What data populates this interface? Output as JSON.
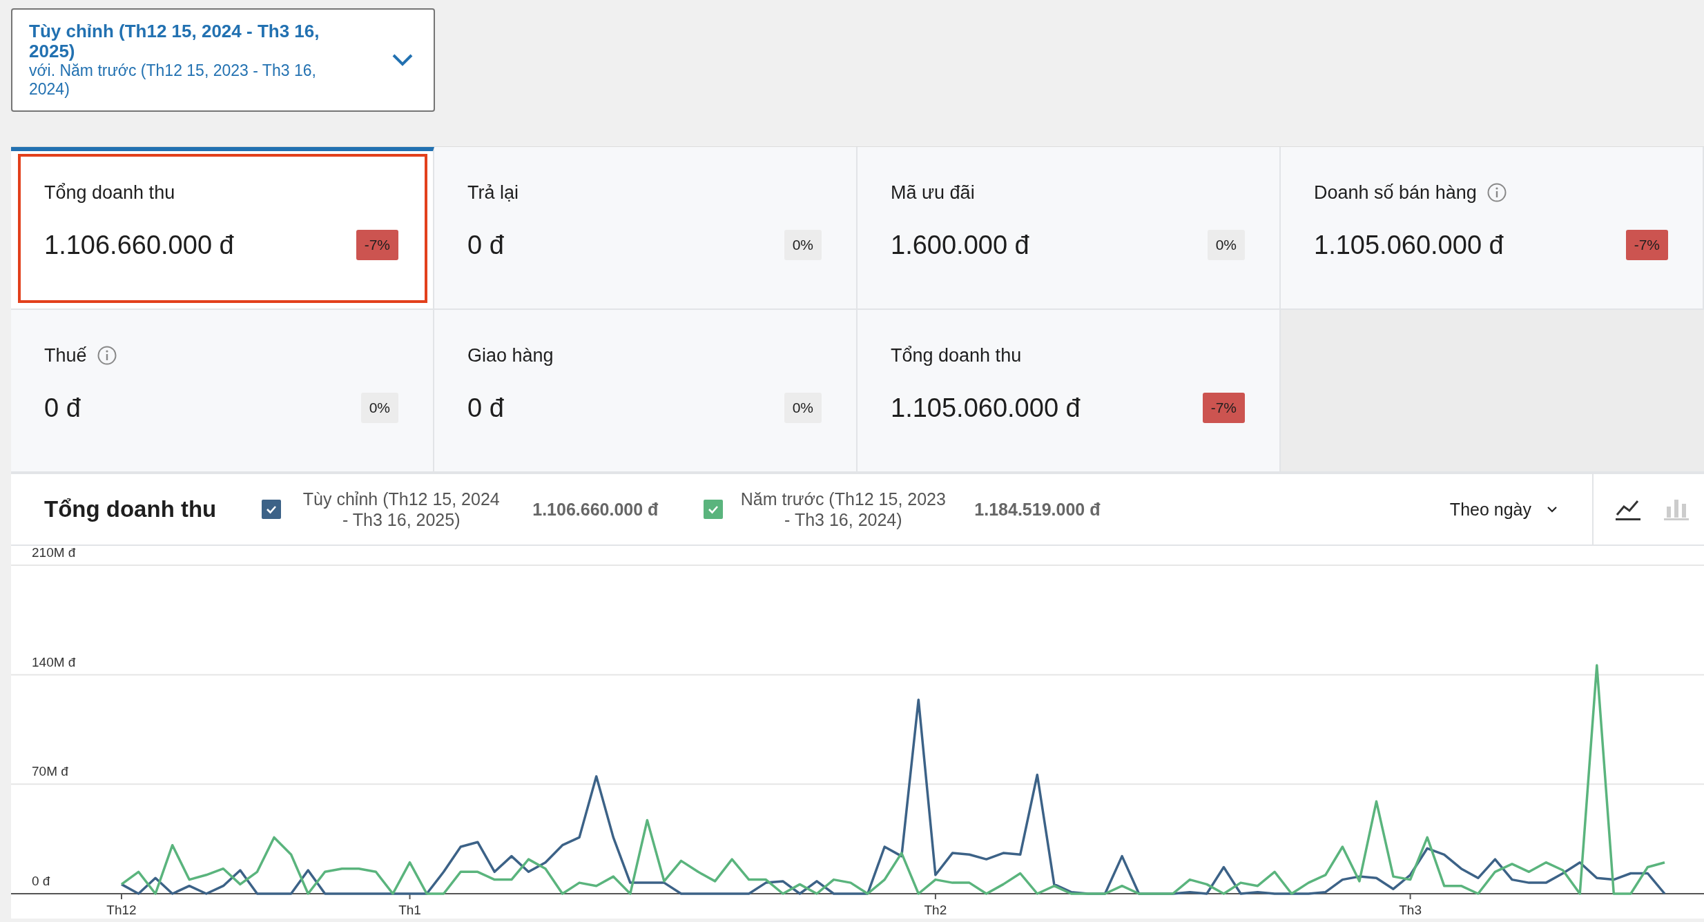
{
  "date_picker": {
    "title": "Tùy chỉnh (Th12 15, 2024 - Th3 16, 2025)",
    "compare": "với. Năm trước (Th12 15, 2023 - Th3 16, 2024)"
  },
  "cards": [
    {
      "label": "Tổng doanh thu",
      "value": "1.106.660.000 đ",
      "delta": "-7%",
      "kind": "negative",
      "info": false,
      "selected": true
    },
    {
      "label": "Trả lại",
      "value": "0 đ",
      "delta": "0%",
      "kind": "neutral",
      "info": false,
      "selected": false
    },
    {
      "label": "Mã ưu đãi",
      "value": "1.600.000 đ",
      "delta": "0%",
      "kind": "neutral",
      "info": false,
      "selected": false
    },
    {
      "label": "Doanh số bán hàng",
      "value": "1.105.060.000 đ",
      "delta": "-7%",
      "kind": "negative",
      "info": true,
      "selected": false
    },
    {
      "label": "Thuế",
      "value": "0 đ",
      "delta": "0%",
      "kind": "neutral",
      "info": true,
      "selected": false
    },
    {
      "label": "Giao hàng",
      "value": "0 đ",
      "delta": "0%",
      "kind": "neutral",
      "info": false,
      "selected": false
    },
    {
      "label": "Tổng doanh thu",
      "value": "1.105.060.000 đ",
      "delta": "-7%",
      "kind": "negative",
      "info": false,
      "selected": false
    }
  ],
  "chart_panel": {
    "title": "Tổng doanh thu",
    "legend": [
      {
        "total": "1.106.660.000 đ",
        "checked": true
      },
      {
        "total": "1.184.519.000 đ",
        "checked": true
      }
    ],
    "interval": "Theo ngày",
    "chart_types": [
      {
        "kind": "line",
        "selected": true
      },
      {
        "kind": "bar",
        "selected": false
      }
    ],
    "chart_data": {
      "type": "line",
      "categories": [
        "Th12",
        null,
        null,
        null,
        null,
        null,
        null,
        null,
        null,
        null,
        null,
        null,
        null,
        null,
        null,
        null,
        null,
        "Th1",
        null,
        null,
        null,
        null,
        null,
        null,
        null,
        null,
        null,
        null,
        null,
        null,
        null,
        null,
        null,
        null,
        null,
        null,
        null,
        null,
        null,
        null,
        null,
        null,
        null,
        null,
        null,
        null,
        null,
        null,
        "Th2",
        null,
        null,
        null,
        null,
        null,
        null,
        null,
        null,
        null,
        null,
        null,
        null,
        null,
        null,
        null,
        null,
        null,
        null,
        null,
        null,
        null,
        null,
        null,
        null,
        null,
        null,
        null,
        "Th3",
        null,
        null,
        null,
        null,
        null,
        null,
        null,
        null,
        null,
        null,
        null,
        null,
        null,
        null,
        null
      ],
      "series": [
        {
          "name": "Tùy chỉnh (Th12 15, 2024 - Th3 16, 2025)",
          "color": "#3c6287",
          "values": [
            6,
            0,
            10,
            0,
            5,
            0,
            5,
            15,
            0,
            0,
            0,
            15,
            0,
            0,
            0,
            0,
            0,
            0,
            0,
            14,
            30,
            33,
            14,
            24,
            14,
            20,
            31,
            36,
            75,
            36,
            7,
            7,
            7,
            0,
            0,
            0,
            0,
            0,
            7,
            8,
            0,
            8,
            0,
            0,
            0,
            30,
            24,
            124,
            12,
            26,
            25,
            22,
            26,
            25,
            76,
            6,
            1,
            0,
            0,
            24,
            0,
            0,
            0,
            1,
            0,
            17,
            0,
            1,
            0,
            0,
            0,
            1,
            9,
            11,
            10,
            3,
            12,
            29,
            25,
            16,
            10,
            22,
            9,
            7,
            7,
            13,
            20,
            10,
            9,
            13,
            13,
            0
          ]
        },
        {
          "name": "Năm trước (Th12 15, 2023 - Th3 16, 2024)",
          "color": "#5ab47d",
          "values": [
            6,
            14,
            0,
            31,
            9,
            12,
            16,
            6,
            14,
            36,
            25,
            0,
            14,
            16,
            16,
            14,
            0,
            20,
            0,
            0,
            14,
            14,
            9,
            9,
            22,
            16,
            0,
            7,
            5,
            11,
            0,
            47,
            8,
            21,
            14,
            8,
            22,
            9,
            9,
            0,
            6,
            0,
            9,
            7,
            0,
            9,
            26,
            0,
            9,
            7,
            7,
            0,
            6,
            13,
            0,
            5,
            0,
            0,
            0,
            5,
            0,
            0,
            0,
            9,
            6,
            0,
            7,
            5,
            14,
            0,
            7,
            12,
            30,
            8,
            59,
            11,
            9,
            36,
            5,
            5,
            0,
            14,
            19,
            14,
            20,
            15,
            0,
            146,
            0,
            0,
            17,
            20
          ]
        }
      ],
      "ylim": [
        0,
        210
      ],
      "yticks": [
        {
          "value": 0,
          "label": "0 đ"
        },
        {
          "value": 70,
          "label": "70M đ"
        },
        {
          "value": 140,
          "label": "140M đ"
        },
        {
          "value": 210,
          "label": "210M đ"
        }
      ]
    }
  }
}
